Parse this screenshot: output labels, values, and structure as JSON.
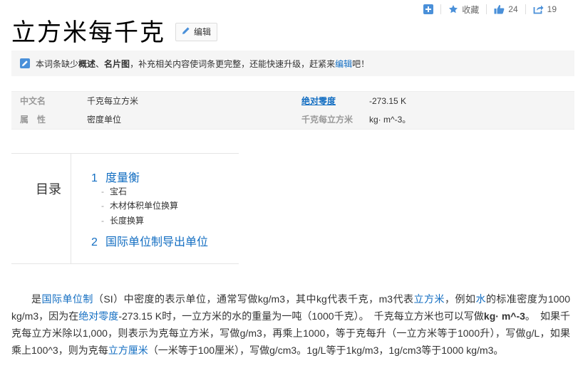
{
  "topbar": {
    "favorite_label": "收藏",
    "like_count": "24",
    "share_count": "19"
  },
  "title": "立方米每千克",
  "edit_button": "编辑",
  "notice": {
    "prefix": "本词条缺少",
    "item1": "概述",
    "sep": "、",
    "item2": "名片图",
    "middle": "，补充相关内容使词条更完整，还能快速升级，赶紧来",
    "link": "编辑",
    "suffix": "吧！"
  },
  "info": {
    "rows": [
      {
        "key": "中文名",
        "value": "千克每立方米",
        "key2": "绝对零度",
        "value2": "-273.15 K"
      },
      {
        "key": "属　性",
        "value": "密度单位",
        "key2": "千克每立方米",
        "value2": "kg· m^-3。"
      }
    ]
  },
  "toc": {
    "title": "目录",
    "sections": [
      {
        "num": "1",
        "label": "度量衡",
        "children": [
          "宝石",
          "木材体积单位换算",
          "长度换算"
        ]
      },
      {
        "num": "2",
        "label": "国际单位制导出单位",
        "children": []
      }
    ],
    "dash": "-"
  },
  "paragraph": {
    "s1": "是",
    "l1": "国际单位制",
    "s2": "（SI）中密度的表示单位，通常写做kg/m3，其中kg代表千克，m3代表",
    "l2": "立方米",
    "s3": "，例如",
    "l3": "水",
    "s4": "的标准密度为1000 kg/m3，因为在",
    "l4": "绝对零度",
    "s5": "-273.15 K时，一立方米的水的重量为一吨（1000千克）。　千克每立方米也可以写做",
    "b1": "kg· m^-3",
    "s6": "。　如果千克每立方米除以1,000，则表示为克每立方米，写做g/m3，再乘上1000，等于克每升（一立方米等于1000升），写做g/L，如果乘上100^3，则为克每",
    "l5": "立方厘米",
    "s7": "（一米等于100厘米），写做g/cm3。1g/L等于1kg/m3，1g/cm3等于1000 kg/m3。"
  },
  "colors": {
    "link": "#136ec2",
    "accent": "#4a90d9",
    "panel_bg": "#f5f5f5"
  }
}
